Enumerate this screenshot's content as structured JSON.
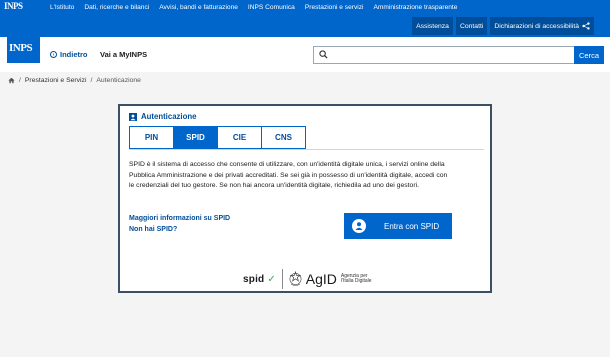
{
  "top_nav": {
    "logo": "INPS",
    "items": [
      "L'Istituto",
      "Dati, ricerche e bilanci",
      "Avvisi, bandi e fatturazione",
      "INPS Comunica",
      "Prestazioni e servizi",
      "Amministrazione trasparente"
    ]
  },
  "utility": {
    "buttons": [
      "Assistenza",
      "Contatti",
      "Dichiarazioni di accessibilità"
    ]
  },
  "header": {
    "logo": "INPS",
    "back_label": "Indietro",
    "myinps_label": "Vai a MyINPS",
    "search_placeholder": "",
    "search_button": "Cerca"
  },
  "breadcrumb": {
    "items": [
      "Prestazioni e Servizi",
      "Autenticazione"
    ]
  },
  "auth": {
    "title": "Autenticazione",
    "tabs": [
      {
        "label": "PIN",
        "active": false
      },
      {
        "label": "SPID",
        "active": true
      },
      {
        "label": "CIE",
        "active": false
      },
      {
        "label": "CNS",
        "active": false
      }
    ],
    "description_lines": [
      "SPID è il sistema di accesso che consente di utilizzare, con un'identità digitale unica, i servizi online della",
      "Pubblica Amministrazione e dei privati accreditati. Se sei già in possesso di un'identità digitale, accedi con",
      "le credenziali del tuo gestore. Se non hai ancora un'identità digitale, richiedila ad uno dei gestori."
    ],
    "links": [
      "Maggiori informazioni su SPID",
      "Non hai SPID?"
    ],
    "spid_button": "Entra con SPID",
    "footer": {
      "spid_logo": "spid",
      "agid_logo": "AgID",
      "agid_sub_lines": [
        "Agenzia per",
        "l'Italia Digitale"
      ]
    }
  },
  "colors": {
    "primary": "#0066cc",
    "dark_blue": "#004d99",
    "card_border": "#3d4f62",
    "spid_green": "#2bb24c"
  }
}
